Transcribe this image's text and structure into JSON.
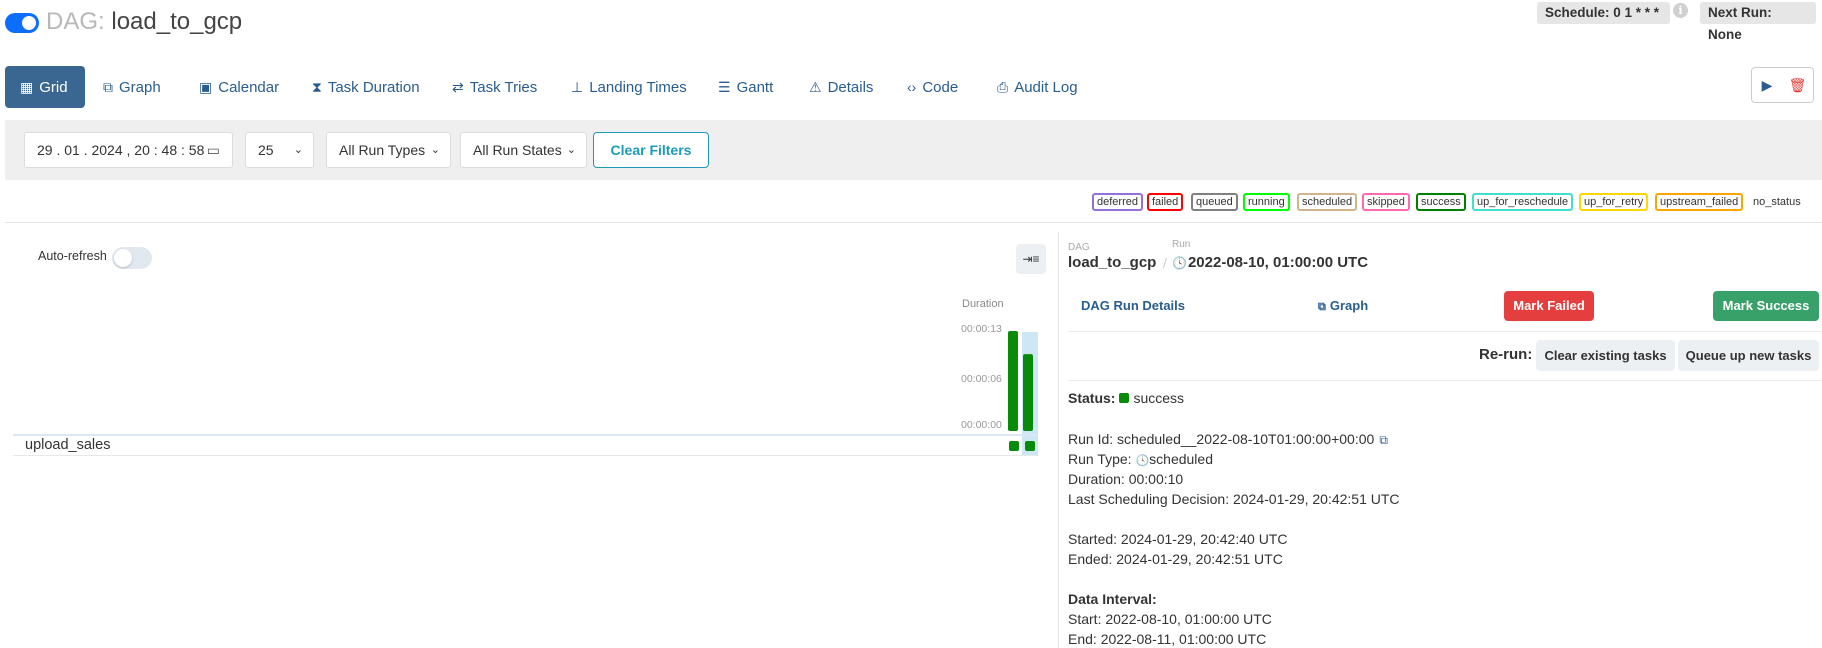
{
  "header": {
    "dag_label": "DAG:",
    "dag_name": "load_to_gcp",
    "schedule": "Schedule: 0 1 * * *",
    "next_run": "Next Run: None"
  },
  "tabs": [
    {
      "label": "Grid",
      "icon": "grid-icon",
      "active": true
    },
    {
      "label": "Graph",
      "icon": "graph-icon"
    },
    {
      "label": "Calendar",
      "icon": "calendar-icon"
    },
    {
      "label": "Task Duration",
      "icon": "hourglass-icon"
    },
    {
      "label": "Task Tries",
      "icon": "retry-icon"
    },
    {
      "label": "Landing Times",
      "icon": "landing-icon"
    },
    {
      "label": "Gantt",
      "icon": "gantt-icon"
    },
    {
      "label": "Details",
      "icon": "warning-triangle-icon"
    },
    {
      "label": "Code",
      "icon": "code-icon"
    },
    {
      "label": "Audit Log",
      "icon": "file-search-icon"
    }
  ],
  "filters": {
    "date_value": "29 . 01 . 2024 ,  20 : 48 : 58",
    "num_runs": "25",
    "run_types": "All Run Types",
    "run_states": "All Run States",
    "clear_label": "Clear Filters"
  },
  "legend": [
    {
      "label": "deferred",
      "color": "#9370db"
    },
    {
      "label": "failed",
      "color": "#ff0000"
    },
    {
      "label": "queued",
      "color": "#808080"
    },
    {
      "label": "running",
      "color": "#00ff00"
    },
    {
      "label": "scheduled",
      "color": "#d2b48c"
    },
    {
      "label": "skipped",
      "color": "#ff69b4"
    },
    {
      "label": "success",
      "color": "#008000"
    },
    {
      "label": "up_for_reschedule",
      "color": "#40e0d0"
    },
    {
      "label": "up_for_retry",
      "color": "#ffd700"
    },
    {
      "label": "upstream_failed",
      "color": "#ffa500"
    },
    {
      "label": "no_status",
      "color": "none"
    }
  ],
  "grid": {
    "auto_refresh_label": "Auto-refresh",
    "duration_label": "Duration",
    "ticks": [
      "00:00:13",
      "00:00:06",
      "00:00:00"
    ],
    "task_name": "upload_sales",
    "run_durations_sec": [
      13,
      10
    ],
    "success_color": "#098a09"
  },
  "details": {
    "crumb_dag_label": "DAG",
    "crumb_dag": "load_to_gcp",
    "crumb_run_label": "Run",
    "crumb_run": "2022-08-10, 01:00:00 UTC",
    "run_details_link": "DAG Run Details",
    "graph_link": "Graph",
    "mark_failed": "Mark Failed",
    "mark_success": "Mark Success",
    "rerun_label": "Re-run:",
    "clear_existing": "Clear existing tasks",
    "queue_up": "Queue up new tasks",
    "status_label": "Status:",
    "status_value": "success",
    "run_id": "Run Id: scheduled__2022-08-10T01:00:00+00:00",
    "run_type_label": "Run Type:",
    "run_type_value": "scheduled",
    "duration": "Duration: 00:00:10",
    "last_sched": "Last Scheduling Decision: 2024-01-29, 20:42:51 UTC",
    "started": "Started: 2024-01-29, 20:42:40 UTC",
    "ended": "Ended: 2024-01-29, 20:42:51 UTC",
    "data_interval_label": "Data Interval:",
    "di_start": "Start: 2022-08-10, 01:00:00 UTC",
    "di_end": "End: 2022-08-11, 01:00:00 UTC"
  }
}
